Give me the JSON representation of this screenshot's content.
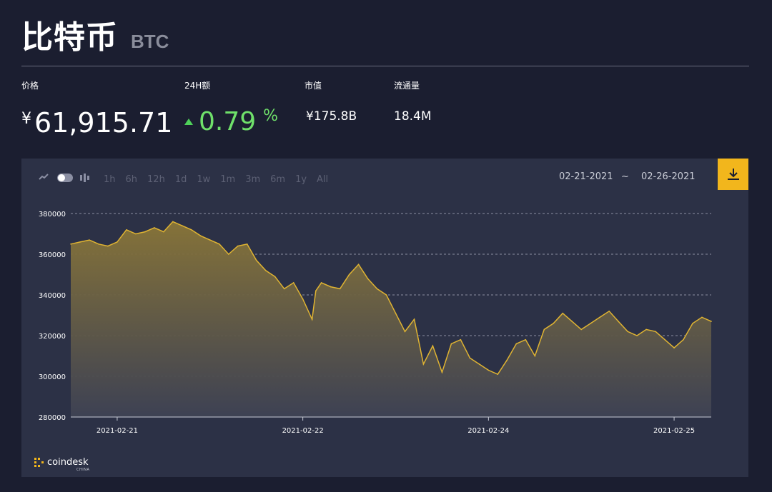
{
  "header": {
    "title": "比特币",
    "symbol": "BTC"
  },
  "stats": {
    "price_label": "价格",
    "price_currency": "¥",
    "price_value": "61,915.71",
    "change_label": "24H额",
    "change_value": "0.79",
    "change_unit": "%",
    "market_cap_label": "市值",
    "market_cap_value": "¥175.8B",
    "supply_label": "流通量",
    "supply_value": "18.4M"
  },
  "toolbar": {
    "ranges": [
      "1h",
      "6h",
      "12h",
      "1d",
      "1w",
      "1m",
      "3m",
      "6m",
      "1y",
      "All"
    ],
    "date_from": "02-21-2021",
    "date_sep": "~",
    "date_to": "02-26-2021"
  },
  "colors": {
    "background": "#1b1e30",
    "panel": "#2c3146",
    "line": "#e0b432",
    "positive": "#6fe06a",
    "accent": "#f2b61c"
  },
  "icons": {
    "chart_line": "line-chart-icon",
    "toggle": "toggle-switch",
    "candle": "candlestick-icon",
    "download": "download-icon"
  },
  "brand": {
    "name": "coindesk",
    "sub": "CHINA"
  },
  "chart_data": {
    "type": "area",
    "title": "",
    "xlabel": "",
    "ylabel": "",
    "ylim": [
      280000,
      380000
    ],
    "yticks": [
      380000,
      360000,
      340000,
      320000,
      300000,
      280000
    ],
    "ytick_labels": [
      "380000",
      "360000",
      "340000",
      "320000",
      "300000",
      "280000"
    ],
    "xticks": [
      0.25,
      1.25,
      2.25,
      3.25
    ],
    "xtick_labels": [
      "2021-02-21",
      "2021-02-22",
      "2021-02-24",
      "2021-02-25"
    ],
    "xlim": [
      0,
      3.45
    ],
    "grid": "horizontal-dashed",
    "series": [
      {
        "x": [
          0,
          0.05,
          0.1,
          0.15,
          0.2,
          0.25,
          0.3,
          0.35,
          0.4,
          0.45,
          0.5,
          0.55,
          0.6,
          0.65,
          0.7,
          0.75,
          0.8,
          0.85,
          0.9,
          0.95,
          1.0,
          1.05,
          1.1,
          1.15,
          1.2,
          1.25,
          1.3,
          1.32,
          1.35,
          1.4,
          1.45,
          1.5,
          1.55,
          1.6,
          1.65,
          1.7,
          1.75,
          1.8,
          1.85,
          1.9,
          1.95,
          2.0,
          2.05,
          2.1,
          2.15,
          2.2,
          2.25,
          2.3,
          2.35,
          2.4,
          2.45,
          2.5,
          2.55,
          2.6,
          2.65,
          2.7,
          2.75,
          2.8,
          2.85,
          2.9,
          2.95,
          3.0,
          3.05,
          3.1,
          3.15,
          3.2,
          3.25,
          3.3,
          3.35,
          3.4,
          3.45
        ],
        "values": [
          365000,
          366000,
          367000,
          365000,
          364000,
          366000,
          372000,
          370000,
          371000,
          373000,
          371000,
          376000,
          374000,
          372000,
          369000,
          367000,
          365000,
          360000,
          364000,
          365000,
          357000,
          352000,
          349000,
          343000,
          346000,
          338000,
          328000,
          342000,
          346000,
          344000,
          343000,
          350000,
          355000,
          348000,
          343000,
          340000,
          331000,
          322000,
          328000,
          306000,
          315000,
          302000,
          316000,
          318000,
          309000,
          306000,
          303000,
          301000,
          308000,
          316000,
          318000,
          310000,
          323000,
          326000,
          331000,
          327000,
          323000,
          326000,
          329000,
          332000,
          327000,
          322000,
          320000,
          323000,
          322000,
          318000,
          314000,
          318000,
          326000,
          329000,
          327000
        ]
      }
    ]
  }
}
